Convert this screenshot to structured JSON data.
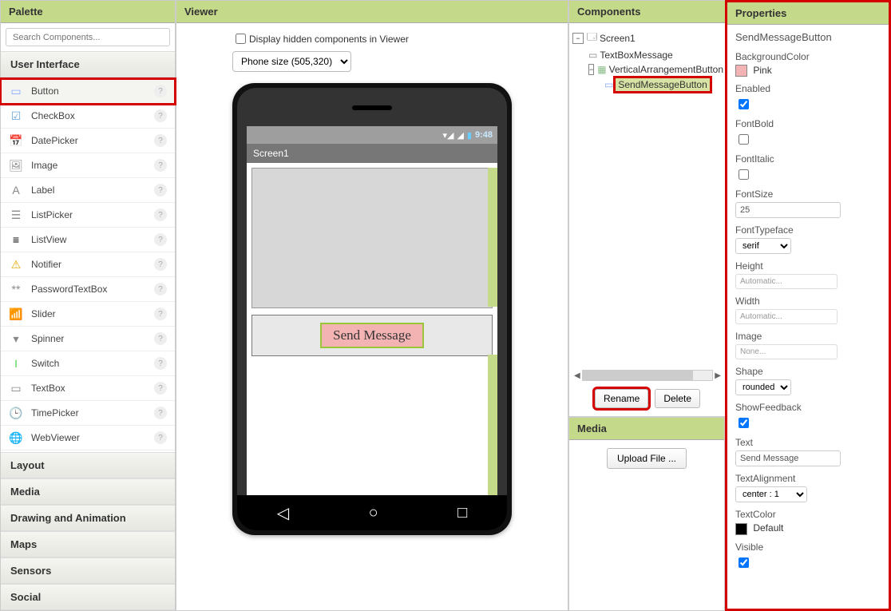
{
  "palette": {
    "title": "Palette",
    "search_placeholder": "Search Components...",
    "categories": {
      "ui": "User Interface",
      "layout": "Layout",
      "media": "Media",
      "drawing": "Drawing and Animation",
      "maps": "Maps",
      "sensors": "Sensors",
      "social": "Social"
    },
    "items": [
      {
        "label": "Button",
        "icon": "button-icon",
        "hl": true
      },
      {
        "label": "CheckBox",
        "icon": "checkbox-icon"
      },
      {
        "label": "DatePicker",
        "icon": "datepicker-icon"
      },
      {
        "label": "Image",
        "icon": "image-icon"
      },
      {
        "label": "Label",
        "icon": "label-icon"
      },
      {
        "label": "ListPicker",
        "icon": "listpicker-icon"
      },
      {
        "label": "ListView",
        "icon": "listview-icon"
      },
      {
        "label": "Notifier",
        "icon": "notifier-icon"
      },
      {
        "label": "PasswordTextBox",
        "icon": "password-icon"
      },
      {
        "label": "Slider",
        "icon": "slider-icon"
      },
      {
        "label": "Spinner",
        "icon": "spinner-icon"
      },
      {
        "label": "Switch",
        "icon": "switch-icon"
      },
      {
        "label": "TextBox",
        "icon": "textbox-icon"
      },
      {
        "label": "TimePicker",
        "icon": "timepicker-icon"
      },
      {
        "label": "WebViewer",
        "icon": "webviewer-icon"
      }
    ]
  },
  "viewer": {
    "title": "Viewer",
    "hidden_label": "Display hidden components in Viewer",
    "size_label": "Phone size (505,320)",
    "screen_title": "Screen1",
    "status_time": "9:48",
    "button_text": "Send Message"
  },
  "components": {
    "title": "Components",
    "tree": {
      "root": "Screen1",
      "child1": "TextBoxMessage",
      "child2": "VerticalArrangementButton",
      "child3": "SendMessageButton"
    },
    "rename": "Rename",
    "delete": "Delete"
  },
  "media": {
    "title": "Media",
    "upload": "Upload File ..."
  },
  "properties": {
    "title": "Properties",
    "component": "SendMessageButton",
    "bgcolor_label": "BackgroundColor",
    "bgcolor_val": "Pink",
    "bgcolor_hex": "#f3b3b3",
    "enabled_label": "Enabled",
    "enabled_val": true,
    "fontbold_label": "FontBold",
    "fontbold_val": false,
    "fontitalic_label": "FontItalic",
    "fontitalic_val": false,
    "fontsize_label": "FontSize",
    "fontsize_val": "25",
    "typeface_label": "FontTypeface",
    "typeface_val": "serif",
    "height_label": "Height",
    "height_val": "Automatic...",
    "width_label": "Width",
    "width_val": "Automatic...",
    "image_label": "Image",
    "image_val": "None...",
    "shape_label": "Shape",
    "shape_val": "rounded",
    "showfb_label": "ShowFeedback",
    "showfb_val": true,
    "text_label": "Text",
    "text_val": "Send Message",
    "align_label": "TextAlignment",
    "align_val": "center : 1",
    "textcolor_label": "TextColor",
    "textcolor_val": "Default",
    "textcolor_hex": "#000000",
    "visible_label": "Visible",
    "visible_val": true
  }
}
